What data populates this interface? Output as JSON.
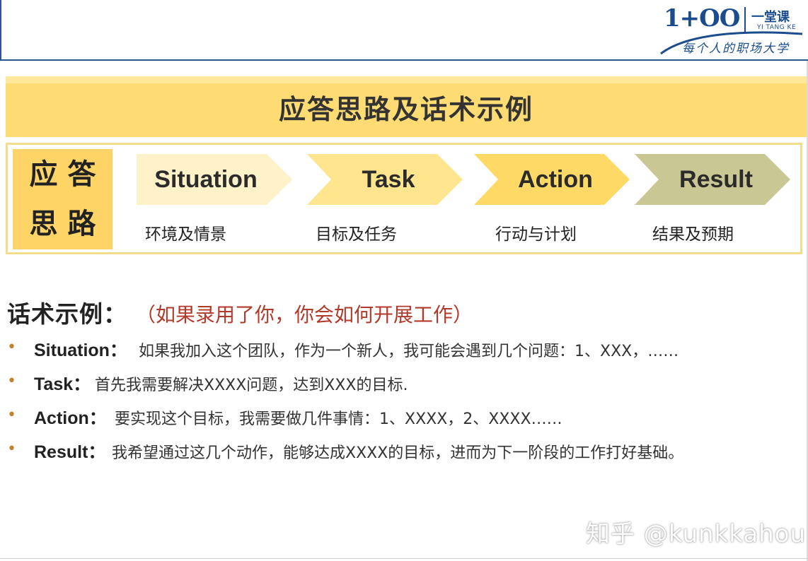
{
  "logo": {
    "mark": "1+OO",
    "name_cn": "一堂课",
    "name_en": "YI TANG KE",
    "slogan": "每个人的职场大学"
  },
  "title": "应答思路及话术示例",
  "side_label": {
    "line1": "应答",
    "line2": "思路"
  },
  "steps": [
    {
      "name": "Situation",
      "desc": "环境及情景"
    },
    {
      "name": "Task",
      "desc": "目标及任务"
    },
    {
      "name": "Action",
      "desc": "行动与计划"
    },
    {
      "name": "Result",
      "desc": "结果及预期"
    }
  ],
  "example": {
    "heading": "话术示例：",
    "question": "（如果录用了你，你会如何开展工作）",
    "items": [
      {
        "key": "Situation：",
        "text": "如果我加入这个团队，作为一个新人，我可能会遇到几个问题：1、XXX，……"
      },
      {
        "key": "Task：",
        "text": "首先我需要解决XXXX问题，达到XXX的目标."
      },
      {
        "key": "Action：",
        "text": "要实现这个目标，我需要做几件事情：1、XXXX，2、XXXX……"
      },
      {
        "key": "Result：",
        "text": "我希望通过这几个动作，能够达成XXXX的目标，进而为下一阶段的工作打好基础。"
      }
    ]
  },
  "watermark": "知乎 @kunkkahou",
  "colors": {
    "brand_blue": "#1b4d8e",
    "title_band": "#ffdb74",
    "question_red": "#b23a2a",
    "bullet_orange": "#c8812a"
  }
}
